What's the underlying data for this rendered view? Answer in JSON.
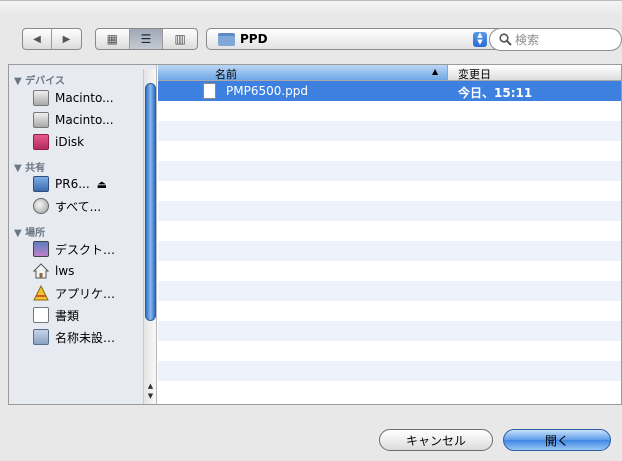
{
  "toolbar": {
    "nav_back": "◀",
    "nav_forward": "▶",
    "view_icons": "▦",
    "view_list": "☰",
    "view_columns": "▥",
    "path_label": "PPD",
    "path_stepper": "▲▼",
    "search_placeholder": "検索"
  },
  "sidebar": {
    "sections": [
      {
        "label": "▼ デバイス"
      },
      {
        "label": "▼ 共有"
      },
      {
        "label": "▼ 場所"
      }
    ],
    "devices": [
      {
        "label": "Macinto...",
        "icon": "hard-drive-icon"
      },
      {
        "label": "Macinto...",
        "icon": "hard-drive-icon"
      },
      {
        "label": "iDisk",
        "icon": "idisk-icon"
      }
    ],
    "shared": [
      {
        "label": "PR6...",
        "icon": "computer-icon",
        "eject": "⏏"
      },
      {
        "label": "すべて...",
        "icon": "network-globe-icon"
      }
    ],
    "places": [
      {
        "label": "デスクト…",
        "icon": "desktop-icon"
      },
      {
        "label": "lws",
        "icon": "home-icon"
      },
      {
        "label": "アプリケ…",
        "icon": "applications-icon"
      },
      {
        "label": "書類",
        "icon": "documents-icon"
      },
      {
        "label": "名称未設…",
        "icon": "folder-icon"
      }
    ],
    "scroll_up": "▲",
    "scroll_down": "▼"
  },
  "filelist": {
    "columns": {
      "name": "名前",
      "date": "変更日",
      "sort": "▲"
    },
    "rows": [
      {
        "name": "PMP6500.ppd",
        "date": "今日、15:11",
        "selected": true
      }
    ]
  },
  "buttons": {
    "cancel": "キャンセル",
    "open": "開く"
  },
  "colors": {
    "selection": "#3d80df",
    "accent": "#5c9ce9"
  }
}
